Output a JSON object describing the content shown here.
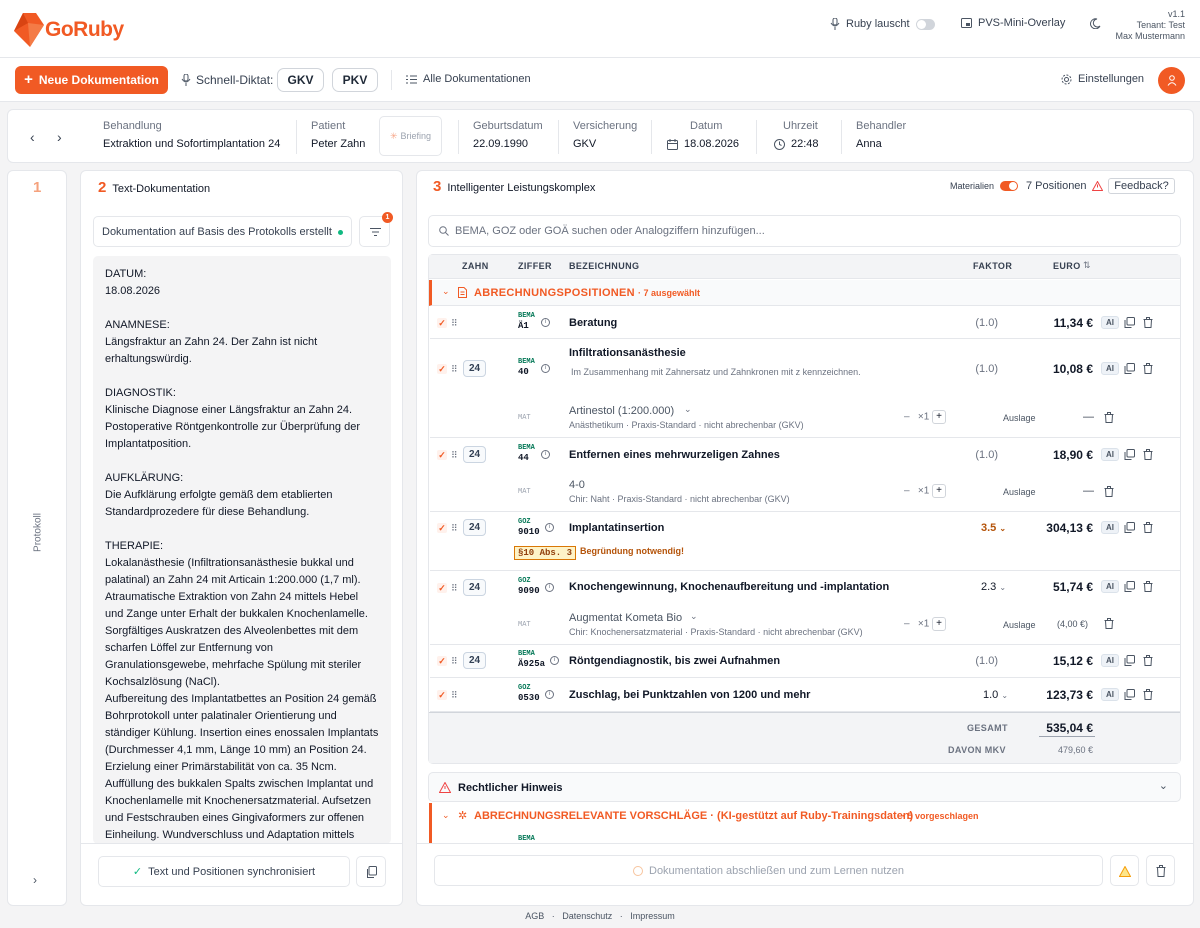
{
  "app": {
    "name": "GoRuby",
    "version": "v1.1",
    "tenant": "Tenant: Test",
    "user": "Max Mustermann"
  },
  "top": {
    "ruby_listen": "Ruby lauscht",
    "pvs_overlay": "PVS-Mini-Overlay"
  },
  "toolbar": {
    "new_doc": "Neue Dokumentation",
    "dictation_label": "Schnell-Diktat:",
    "gkv": "GKV",
    "pkv": "PKV",
    "all_docs": "Alle Dokumentationen",
    "settings": "Einstellungen"
  },
  "patient": {
    "treatment_label": "Behandlung",
    "treatment": "Extraktion und Sofortimplantation 24",
    "patient_label": "Patient",
    "patient": "Peter Zahn",
    "briefing": "Briefing",
    "dob_label": "Geburtsdatum",
    "dob": "22.09.1990",
    "insurance_label": "Versicherung",
    "insurance": "GKV",
    "date_label": "Datum",
    "date": "18.08.2026",
    "time_label": "Uhrzeit",
    "time": "22:48",
    "doctor_label": "Behandler",
    "doctor": "Anna"
  },
  "step1": {
    "number": "1",
    "label": "Protokoll"
  },
  "step2": {
    "number": "2",
    "title": "Text-Dokumentation",
    "select_value": "Dokumentation auf Basis des Protokolls erstellt",
    "filter_badge": "1",
    "text": "DATUM:\n18.08.2026\n\nANAMNESE:\nLängsfraktur an Zahn 24. Der Zahn ist nicht\nerhaltungswürdig.\n\nDIAGNOSTIK:\nKlinische Diagnose einer Längsfraktur an Zahn 24.\nPostoperative Röntgenkontrolle zur Überprüfung der\nImplantatposition.\n\nAUFKLÄRUNG:\nDie Aufklärung erfolgte gemäß dem etablierten\nStandardprozedere für diese Behandlung.\n\nTHERAPIE:\nLokalanästhesie (Infiltrationsanästhesie bukkal und\npalatinal) an Zahn 24 mit Articain 1:200.000 (1,7 ml).\nAtraumatische Extraktion von Zahn 24 mittels Hebel\nund Zange unter Erhalt der bukkalen Knochenlamelle.\nSorgfältiges Auskratzen des Alveolenbettes mit dem\nscharfen Löffel zur Entfernung von\nGranulationsgewebe, mehrfache Spülung mit steriler\nKochsalzlösung (NaCl).\nAufbereitung des Implantatbettes an Position 24 gemäß\nBohrprotokoll unter palatinaler Orientierung und\nständiger Kühlung. Insertion eines enossalen Implantats\n(Durchmesser 4,1 mm, Länge 10 mm) an Position 24.\nErzielung einer Primärstabilität von ca. 35 Ncm.\nAuffüllung des bukkalen Spalts zwischen Implantat und\nKnochenlamelle mit Knochenersatzmaterial. Aufsetzen\nund Festschrauben eines Gingivaformers zur offenen\nEinheilung. Wundverschluss und Adaptation mittels",
    "sync": "Text und Positionen synchronisiert"
  },
  "step3": {
    "number": "3",
    "title": "Intelligenter Leistungskomplex",
    "materials": "Materialien",
    "positions": "7 Positionen",
    "feedback": "Feedback?",
    "search_placeholder": "BEMA, GOZ oder GOÄ suchen oder Analogziffern hinzufügen...",
    "cols": {
      "tooth": "ZAHN",
      "code": "ZIFFER",
      "desc": "BEZEICHNUNG",
      "factor": "FAKTOR",
      "euro": "EURO"
    },
    "section": {
      "title": "ABRECHNUNGSPOSITIONEN",
      "count": "· 7 ausgewählt"
    },
    "rows": [
      {
        "tooth": "",
        "cat": "BEMA",
        "code": "Ä1",
        "name": "Beratung",
        "factor": "(1.0)",
        "euro": "11,34 €"
      },
      {
        "tooth": "24",
        "cat": "BEMA",
        "code": "40",
        "name": "Infiltrationsanästhesie",
        "note": "Im Zusammenhang mit Zahnersatz und Zahnkronen mit z kennzeichnen.",
        "factor": "(1.0)",
        "euro": "10,08 €",
        "mat": {
          "label": "MAT",
          "name": "Artinestol (1:200.000)",
          "sub": "Anästhetikum · Praxis-Standard · nicht abrechenbar (GKV)",
          "qty": "×1",
          "type": "Auslage",
          "value": "—"
        }
      },
      {
        "tooth": "24",
        "cat": "BEMA",
        "code": "44",
        "name": "Entfernen eines mehrwurzeligen Zahnes",
        "factor": "(1.0)",
        "euro": "18,90 €",
        "mat": {
          "label": "MAT",
          "name": "4-0",
          "sub": "Chir: Naht · Praxis-Standard · nicht abrechenbar (GKV)",
          "qty": "×1",
          "type": "Auslage",
          "value": "—"
        }
      },
      {
        "tooth": "24",
        "cat": "GOZ",
        "code": "9010",
        "name": "Implantatinsertion",
        "factor": "3.5",
        "euro": "304,13 €",
        "tag": "§10 Abs. 3",
        "warning": "Begründung notwendig!"
      },
      {
        "tooth": "24",
        "cat": "GOZ",
        "code": "9090",
        "name": "Knochengewinnung, Knochenaufbereitung und -implantation",
        "factor": "2.3",
        "euro": "51,74 €",
        "mat": {
          "label": "MAT",
          "name": "Augmentat Kometa Bio",
          "sub": "Chir: Knochenersatzmaterial · Praxis-Standard · nicht abrechenbar (GKV)",
          "qty": "×1",
          "type": "Auslage",
          "value": "(4,00 €)"
        }
      },
      {
        "tooth": "24",
        "cat": "BEMA",
        "code": "Ä925a",
        "name": "Röntgendiagnostik, bis zwei Aufnahmen",
        "factor": "(1.0)",
        "euro": "15,12 €"
      },
      {
        "tooth": "",
        "cat": "GOZ",
        "code": "0530",
        "name": "Zuschlag, bei Punktzahlen von 1200 und mehr",
        "factor": "1.0",
        "euro": "123,73 €"
      }
    ],
    "total_label": "GESAMT",
    "total": "535,04 €",
    "mkv_label": "DAVON MKV",
    "mkv": "479,60 €",
    "legal": "Rechtlicher Hinweis",
    "suggestions": {
      "title": "ABRECHNUNGSRELEVANTE VORSCHLÄGE · (KI-gestützt auf Ruby-Trainingsdaten)",
      "count": "· 5 vorgeschlagen",
      "next_cat": "BEMA"
    },
    "finish": "Dokumentation abschließen und zum Lernen nutzen",
    "ai": "AI"
  },
  "footer": {
    "agb": "AGB",
    "privacy": "Datenschutz",
    "imprint": "Impressum",
    "sep": "·"
  },
  "colors": {
    "accent": "#f15a24",
    "warning": "#b45309",
    "green": "#047857"
  }
}
